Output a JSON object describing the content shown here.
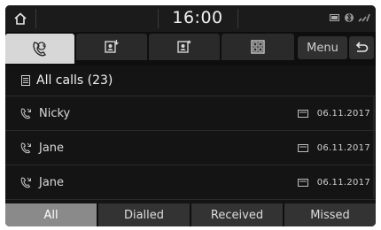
{
  "status": {
    "time": "16:00"
  },
  "tabs": [
    {
      "icon": "call-history-icon",
      "active": true
    },
    {
      "icon": "contacts-download-icon",
      "active": false
    },
    {
      "icon": "favorites-icon",
      "active": false
    },
    {
      "icon": "dialpad-icon",
      "active": false
    }
  ],
  "toolbar": {
    "menu_label": "Menu"
  },
  "list": {
    "header": "All calls (23)",
    "items": [
      {
        "name": "Nicky",
        "date": "06.11.2017"
      },
      {
        "name": "Jane",
        "date": "06.11.2017"
      },
      {
        "name": "Jane",
        "date": "06.11.2017"
      }
    ]
  },
  "filters": [
    {
      "label": "All",
      "active": true
    },
    {
      "label": "Dialled",
      "active": false
    },
    {
      "label": "Received",
      "active": false
    },
    {
      "label": "Missed",
      "active": false
    }
  ],
  "colors": {
    "accent_active_tab": "#d7d7d7",
    "background": "#141414"
  }
}
